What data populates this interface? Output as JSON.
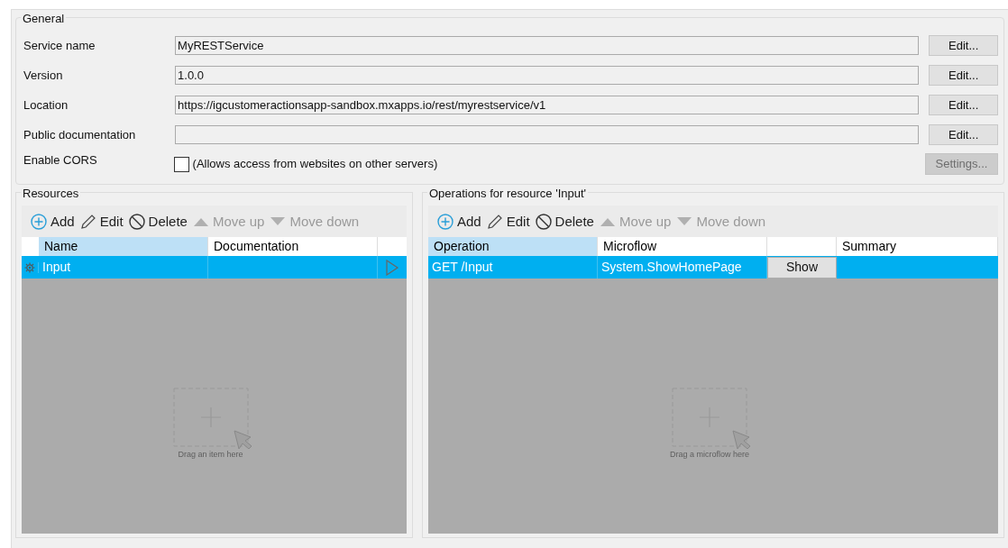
{
  "general": {
    "title": "General",
    "fields": [
      {
        "label": "Service name",
        "value": "MyRESTService",
        "button": "Edit..."
      },
      {
        "label": "Version",
        "value": "1.0.0",
        "button": "Edit..."
      },
      {
        "label": "Location",
        "value": "https://igcustomeractionsapp-sandbox.mxapps.io/rest/myrestservice/v1",
        "button": "Edit..."
      },
      {
        "label": "Public documentation",
        "button": "Edit..."
      }
    ],
    "cors": {
      "label": "Enable CORS",
      "checked": false,
      "text": "(Allows access from websites on other servers)",
      "button": "Settings...",
      "button_disabled": true
    }
  },
  "resources": {
    "title": "Resources",
    "toolbar": [
      {
        "kind": "add",
        "label": "Add",
        "disabled": false
      },
      {
        "kind": "edit",
        "label": "Edit",
        "disabled": false
      },
      {
        "kind": "delete",
        "label": "Delete",
        "disabled": false
      },
      {
        "kind": "up",
        "label": "Move up",
        "disabled": true
      },
      {
        "kind": "down",
        "label": "Move down",
        "disabled": true
      }
    ],
    "columns": [
      {
        "label": "Name",
        "sorted": true
      },
      {
        "label": "Documentation",
        "sorted": false
      }
    ],
    "rows": [
      {
        "name": "Input",
        "selected": true
      }
    ],
    "drop_hint": "Drag an item here"
  },
  "operations": {
    "title": "Operations for resource 'Input'",
    "toolbar": [
      {
        "kind": "add",
        "label": "Add",
        "disabled": false
      },
      {
        "kind": "edit",
        "label": "Edit",
        "disabled": false
      },
      {
        "kind": "delete",
        "label": "Delete",
        "disabled": false
      },
      {
        "kind": "up",
        "label": "Move up",
        "disabled": true
      },
      {
        "kind": "down",
        "label": "Move down",
        "disabled": true
      }
    ],
    "columns": [
      {
        "label": "Operation",
        "sorted": true
      },
      {
        "label": "Microflow",
        "sorted": false
      },
      {
        "label": "Summary",
        "sorted": false
      }
    ],
    "rows": [
      {
        "operation": "GET /Input",
        "microflow": "System.ShowHomePage",
        "button": "Show",
        "selected": true
      }
    ],
    "drop_hint": "Drag a microflow here"
  }
}
